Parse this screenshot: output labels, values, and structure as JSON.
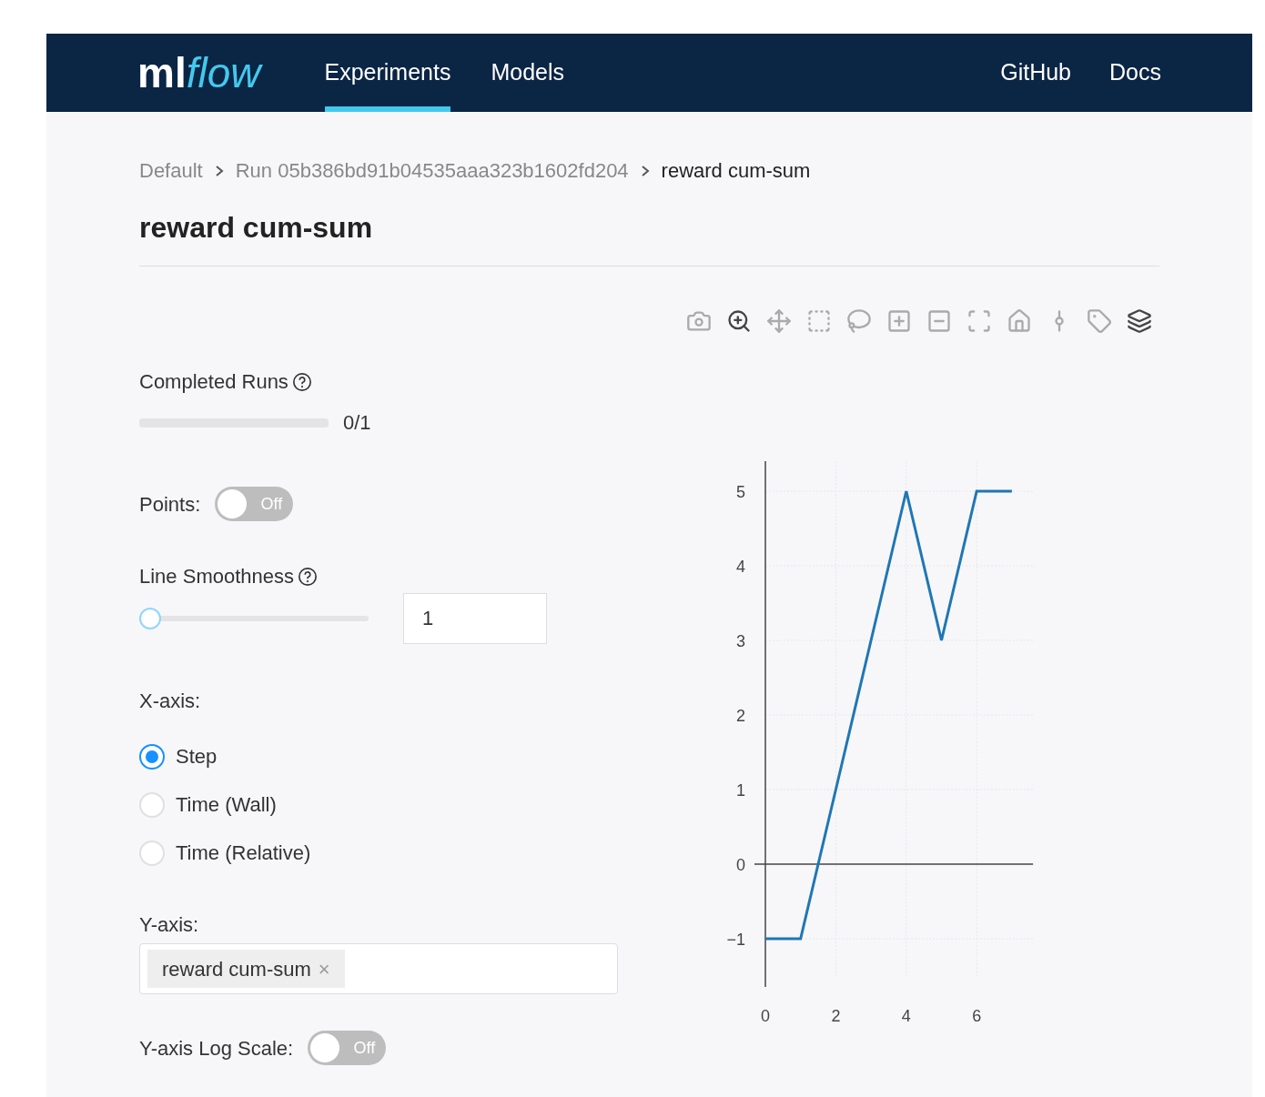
{
  "nav": {
    "logo": {
      "part_1": "ml",
      "part_2": "flow"
    },
    "tabs": [
      {
        "label": "Experiments",
        "selected": true
      },
      {
        "label": "Models",
        "selected": false
      }
    ],
    "links": [
      "GitHub",
      "Docs"
    ]
  },
  "breadcrumb": [
    "Default",
    "Run 05b386bd91b04535aaa323b1602fd204",
    "reward cum-sum"
  ],
  "title": "reward cum-sum",
  "completed_runs": {
    "label": "Completed Runs",
    "level": 0,
    "reading": "0/1"
  },
  "points": {
    "label": "Points:",
    "on": false,
    "text": "Off"
  },
  "line_smoothness": {
    "label": "Line Smoothness",
    "level": 0,
    "value": "1"
  },
  "x_axis": {
    "label": "X-axis:",
    "options": [
      {
        "label": "Step",
        "selected": true
      },
      {
        "label": "Time (Wall)",
        "selected": false
      },
      {
        "label": "Time (Relative)",
        "selected": false
      }
    ]
  },
  "y_axis": {
    "label": "Y-axis:",
    "tags": [
      {
        "label": "reward cum-sum",
        "remove": "×"
      }
    ]
  },
  "y_log_scale": {
    "label": "Y-axis Log Scale:",
    "on": false,
    "text": "Off"
  },
  "chart": {
    "chart_data": {
      "type": "line",
      "x": [
        0,
        1,
        2,
        3,
        4,
        5,
        6,
        7
      ],
      "series": [
        {
          "color": "#1f77b4",
          "values": [
            -1,
            -1,
            1,
            3,
            5,
            3,
            5,
            5
          ]
        }
      ],
      "xticks": [
        0,
        2,
        4,
        6
      ],
      "yticks": [
        {
          "value": -1,
          "label": "−1"
        },
        {
          "value": 0,
          "label": "0"
        },
        {
          "value": 1,
          "label": "1"
        },
        {
          "value": 2,
          "label": "2"
        },
        {
          "value": 3,
          "label": "3"
        },
        {
          "value": 4,
          "label": "4"
        },
        {
          "value": 5,
          "label": "5"
        }
      ],
      "xlim": [
        0,
        7.6
      ],
      "ylim": [
        -1.5,
        5.4
      ],
      "grid": true
    }
  }
}
